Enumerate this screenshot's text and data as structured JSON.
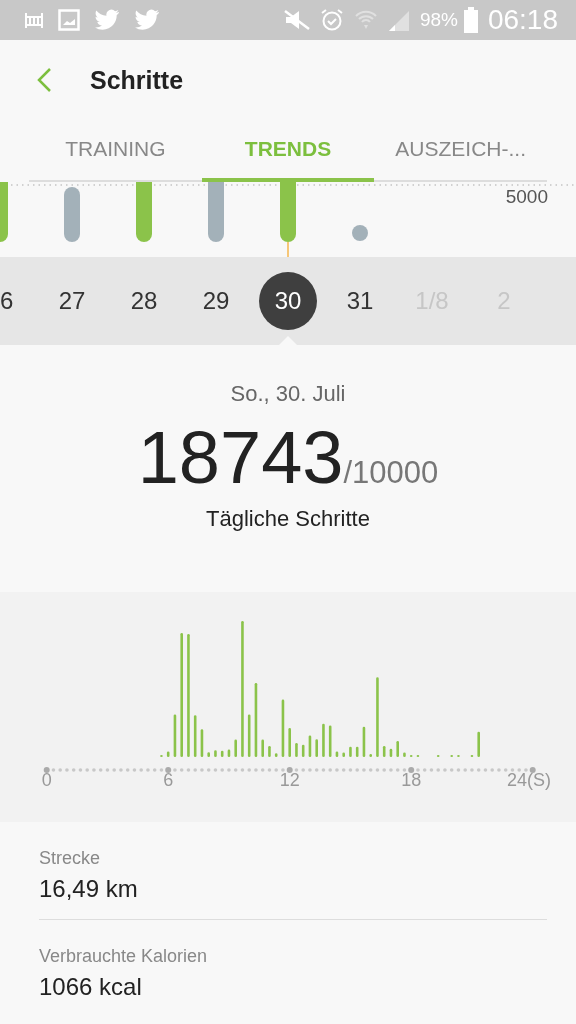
{
  "status_bar": {
    "battery": "98%",
    "time": "06:18"
  },
  "header": {
    "title": "Schritte"
  },
  "tabs": [
    {
      "label": "TRAINING",
      "selected": false
    },
    {
      "label": "TRENDS",
      "selected": true
    },
    {
      "label": "AUSZEICH-...",
      "selected": false
    }
  ],
  "weekly_chart": {
    "goal_label": "5000"
  },
  "days": [
    {
      "label": "6",
      "selected": false,
      "disabled": false,
      "goal_met": true
    },
    {
      "label": "27",
      "selected": false,
      "disabled": false,
      "goal_met": false
    },
    {
      "label": "28",
      "selected": false,
      "disabled": false,
      "goal_met": true
    },
    {
      "label": "29",
      "selected": false,
      "disabled": false,
      "goal_met": false
    },
    {
      "label": "30",
      "selected": true,
      "disabled": false,
      "goal_met": true
    },
    {
      "label": "31",
      "selected": false,
      "disabled": false,
      "goal_met": false
    },
    {
      "label": "1/8",
      "selected": false,
      "disabled": true
    },
    {
      "label": "2",
      "selected": false,
      "disabled": true
    }
  ],
  "summary": {
    "date": "So., 30. Juli",
    "steps": "18743",
    "goal": "/10000",
    "caption": "Tägliche Schritte"
  },
  "hourly_chart": {
    "x_labels": [
      "0",
      "6",
      "12",
      "18",
      "24(S)"
    ]
  },
  "stats": [
    {
      "label": "Strecke",
      "value": "16,49 km"
    },
    {
      "label": "Verbrauchte Kalorien",
      "value": "1066 kcal"
    }
  ]
}
